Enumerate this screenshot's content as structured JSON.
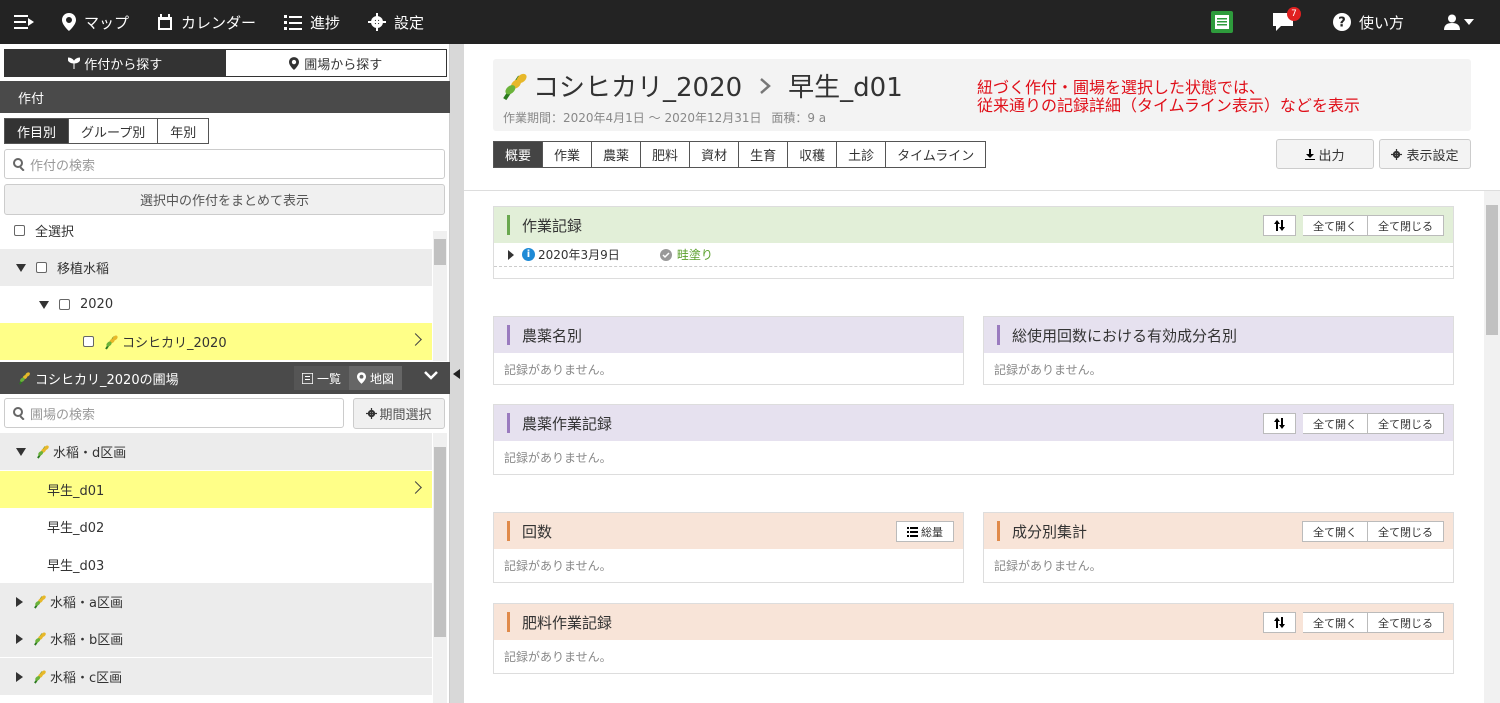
{
  "topbar": {
    "items": [
      {
        "label": "マップ",
        "icon": "map-pin-icon"
      },
      {
        "label": "カレンダー",
        "icon": "calendar-icon"
      },
      {
        "label": "進捗",
        "icon": "progress-list-icon"
      },
      {
        "label": "設定",
        "icon": "gear-icon"
      }
    ],
    "notification_count": "7",
    "help_label": "使い方"
  },
  "left": {
    "toggle": {
      "by_crop": "作付から探す",
      "by_field": "圃場から探す"
    },
    "section_title": "作付",
    "tabs": [
      "作目別",
      "グループ別",
      "年別"
    ],
    "crop_search_placeholder": "作付の検索",
    "show_selected_label": "選択中の作付をまとめて表示",
    "select_all": "全選択",
    "tree": {
      "group": "移植水稲",
      "year": "2020",
      "crop": "コシヒカリ_2020"
    },
    "farm_head": "コシヒカリ_2020の圃場",
    "farm_tabs": {
      "list": "一覧",
      "map": "地図"
    },
    "field_search_placeholder": "圃場の検索",
    "period_label": "期間選択",
    "fields": {
      "area_d": "水稲・d区画",
      "items": [
        "早生_d01",
        "早生_d02",
        "早生_d03"
      ],
      "area_a": "水稲・a区画",
      "area_b": "水稲・b区画",
      "area_c": "水稲・c区画"
    }
  },
  "main": {
    "crop_name": "コシヒカリ_2020",
    "field_name": "早生_d01",
    "period": "作業期間：2020年4月1日 〜 2020年12月31日",
    "area": "面積：9 a",
    "notice_line1": "紐づく作付・圃場を選択した状態では、",
    "notice_line2": "従来通りの記録詳細（タイムライン表示）などを表示",
    "tabs": [
      "概要",
      "作業",
      "農薬",
      "肥料",
      "資材",
      "生育",
      "収穫",
      "土診",
      "タイムライン"
    ],
    "export_label": "出力",
    "display_settings_label": "表示設定",
    "expand_all": "全て開く",
    "collapse_all": "全て閉じる",
    "total_label": "総量",
    "no_records": "記録がありません。",
    "cards": {
      "work": "作業記録",
      "work_date": "2020年3月9日",
      "work_tag": "畦塗り",
      "pesticide_by_name": "農薬名別",
      "active_ingredient": "総使用回数における有効成分名別",
      "pesticide_work": "農薬作業記録",
      "count": "回数",
      "component_total": "成分別集計",
      "fertilizer_work": "肥料作業記録"
    }
  }
}
